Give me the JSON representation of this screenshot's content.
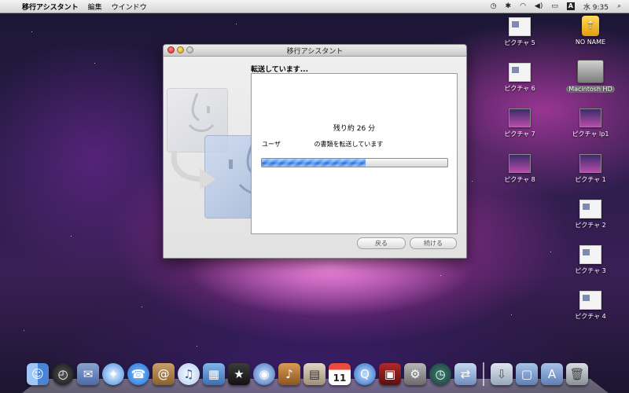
{
  "menubar": {
    "apple_glyph": "",
    "app_name": "移行アシスタント",
    "menus": [
      "編集",
      "ウインドウ"
    ],
    "clock": "水 9:35",
    "input_badge": "A",
    "status_icons": [
      "time-machine-icon",
      "bluetooth-icon",
      "wifi-icon",
      "volume-icon",
      "battery-icon",
      "input-menu-icon",
      "spotlight-icon"
    ]
  },
  "window": {
    "title": "移行アシスタント",
    "heading": "転送しています...",
    "remaining": "残り約 26 分",
    "status_user": "ユーザ",
    "status_text": "の書類を転送しています",
    "progress": 0.56,
    "back_label": "戻る",
    "continue_label": "続ける"
  },
  "desktop": {
    "icons": [
      {
        "label": "ピクチャ 5",
        "kind": "thumb"
      },
      {
        "label": "NO NAME",
        "kind": "usb"
      },
      {
        "label": "ピクチャ 6",
        "kind": "thumb"
      },
      {
        "label": "Macintosh HD",
        "kind": "hdd"
      },
      {
        "label": "ピクチャ 7",
        "kind": "dark"
      },
      {
        "label": "ピクチャ lp1",
        "kind": "dark"
      },
      {
        "label": "ピクチャ 8",
        "kind": "dark"
      },
      {
        "label": "ピクチャ 1",
        "kind": "dark"
      },
      {
        "label": "ピクチャ 2",
        "kind": "thumb"
      },
      {
        "label": "ピクチャ 3",
        "kind": "thumb"
      },
      {
        "label": "ピクチャ 4",
        "kind": "thumb"
      }
    ]
  },
  "dock": {
    "calendar_day": "11",
    "apps": [
      "finder-icon",
      "dashboard-icon",
      "mail-icon",
      "safari-icon",
      "ichat-icon",
      "address-book-icon",
      "itunes-icon",
      "iphoto-icon",
      "imovie-icon",
      "idvd-icon",
      "garageband-icon",
      "preview-icon",
      "ical-icon",
      "quicktime-icon",
      "photo-booth-icon",
      "system-preferences-icon",
      "time-machine-icon",
      "migration-assistant-icon"
    ],
    "right_items": [
      "downloads-stack-icon",
      "documents-folder-icon",
      "applications-folder-icon",
      "trash-icon"
    ]
  }
}
